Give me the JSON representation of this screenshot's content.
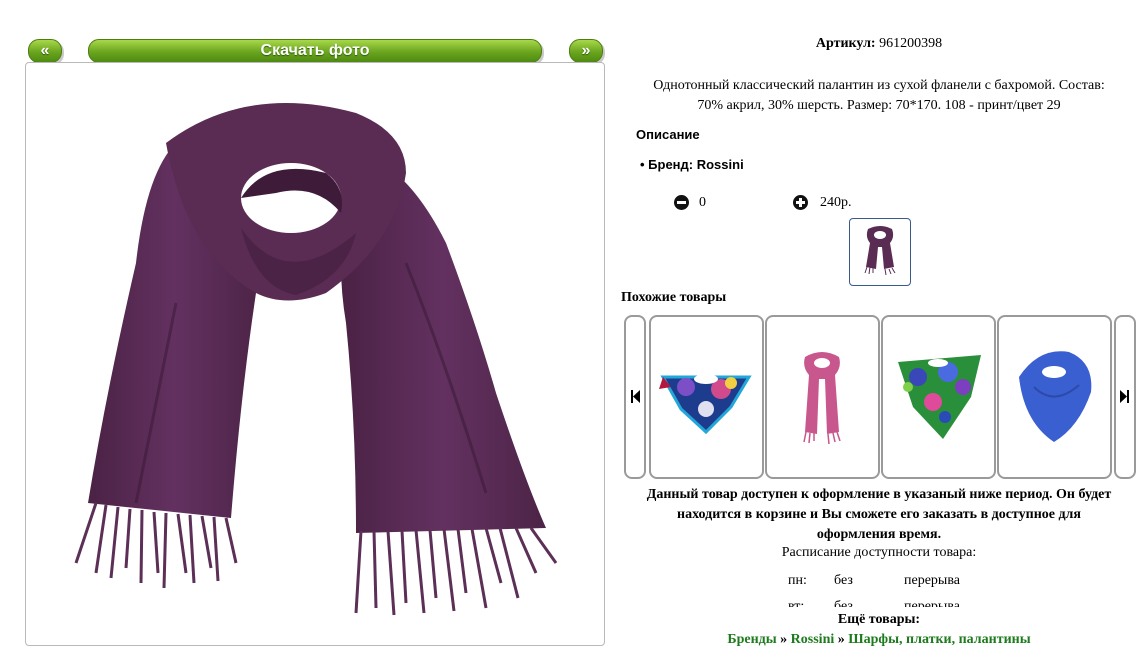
{
  "toolbar": {
    "prev_label": "«",
    "download_label": "Скачать фото",
    "next_label": "»"
  },
  "product": {
    "article_label": "Артикул:",
    "article_value": "961200398",
    "description_line1": "Однотонный классический палантин из сухой фланели с бахромой. Состав:",
    "description_line2": "70% акрил, 30% шерсть. Размер: 70*170. 108 - принт/цвет 29",
    "section_title": "Описание",
    "brand_line": "Бренд: Rossini",
    "quantity": "0",
    "price": "240р."
  },
  "similar": {
    "title": "Похожие товары"
  },
  "availability": {
    "notice_line1": "Данный товар доступен к оформление в указаный ниже период. Он будет",
    "notice_line2": "находится в корзине и Вы сможете его заказать в доступное для",
    "notice_line3": "оформления время.",
    "schedule_title": "Расписание доступности товара:",
    "rows": [
      {
        "day": "пн:",
        "a": "без",
        "b": "перерыва"
      },
      {
        "day": "вт:",
        "a": "без",
        "b": "перерыва"
      }
    ]
  },
  "more": {
    "title": "Ещё товары:",
    "crumb1": "Бренды",
    "sep1": "»",
    "crumb2": "Rossini",
    "sep2": "»",
    "crumb3": "Шарфы, платки, палантины"
  },
  "colors": {
    "accent_green": "#6aa51e",
    "scarf_purple": "#5a2c54",
    "link_green": "#1d7a1d"
  }
}
